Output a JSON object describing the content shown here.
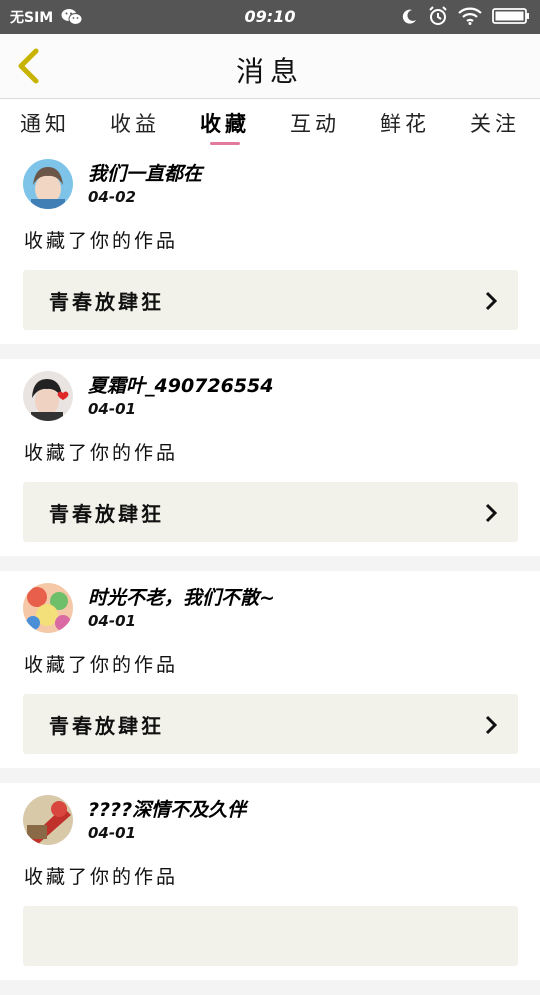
{
  "status_bar": {
    "carrier": "无SIM",
    "time": "09:10",
    "icons": [
      "wechat-icon",
      "moon-icon",
      "alarm-icon",
      "wifi-icon",
      "battery-icon"
    ]
  },
  "header": {
    "title": "消息",
    "back_icon": "chevron-left-icon",
    "accent_color": "#c8b400"
  },
  "tabs": [
    {
      "label": "通知",
      "active": false
    },
    {
      "label": "收益",
      "active": false
    },
    {
      "label": "收藏",
      "active": true
    },
    {
      "label": "互动",
      "active": false
    },
    {
      "label": "鲜花",
      "active": false
    },
    {
      "label": "关注",
      "active": false
    }
  ],
  "tab_indicator_color": "#e27a9b",
  "messages": [
    {
      "username": "我们一直都在",
      "date": "04-02",
      "action": "收藏了你的作品",
      "work_title": "青春放肆狂"
    },
    {
      "username": "夏霜叶_490726554",
      "date": "04-01",
      "action": "收藏了你的作品",
      "work_title": "青春放肆狂"
    },
    {
      "username": "时光不老，我们不散~",
      "date": "04-01",
      "action": "收藏了你的作品",
      "work_title": "青春放肆狂"
    },
    {
      "username": "????深情不及久伴",
      "date": "04-01",
      "action": "收藏了你的作品",
      "work_title": ""
    }
  ]
}
